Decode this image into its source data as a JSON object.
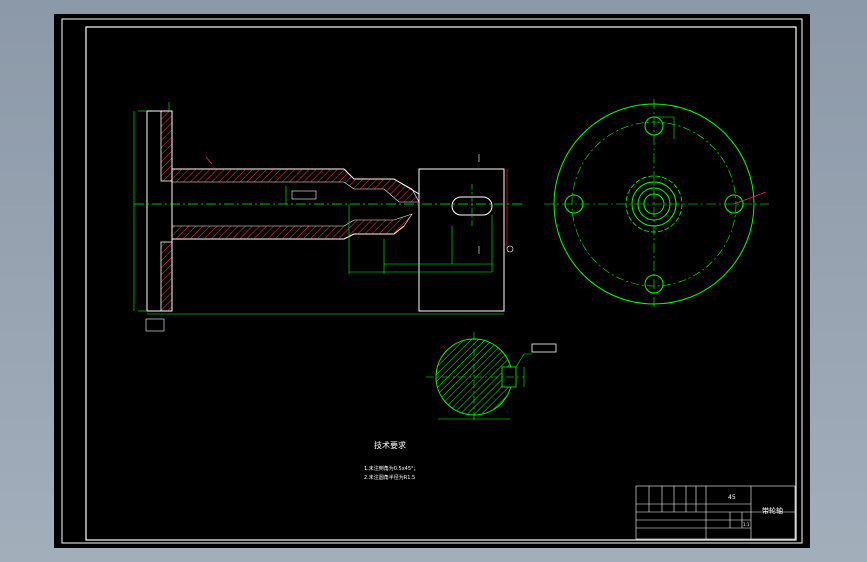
{
  "drawing": {
    "tech_req_title": "技术要求",
    "tech_req_line1": "1.未注倒角为0.5x45°；",
    "tech_req_line2": "2.未注圆角半径为R1.5",
    "material": "45",
    "part_name": "带轮轴",
    "scale": "1:1"
  },
  "colors": {
    "background": "#000000",
    "frame": "#ffffff",
    "outline": "#ffffff",
    "centerline": "#00ff00",
    "hatch": "#ff3030",
    "dimension": "#00ff00",
    "datum": "#ff3030"
  }
}
